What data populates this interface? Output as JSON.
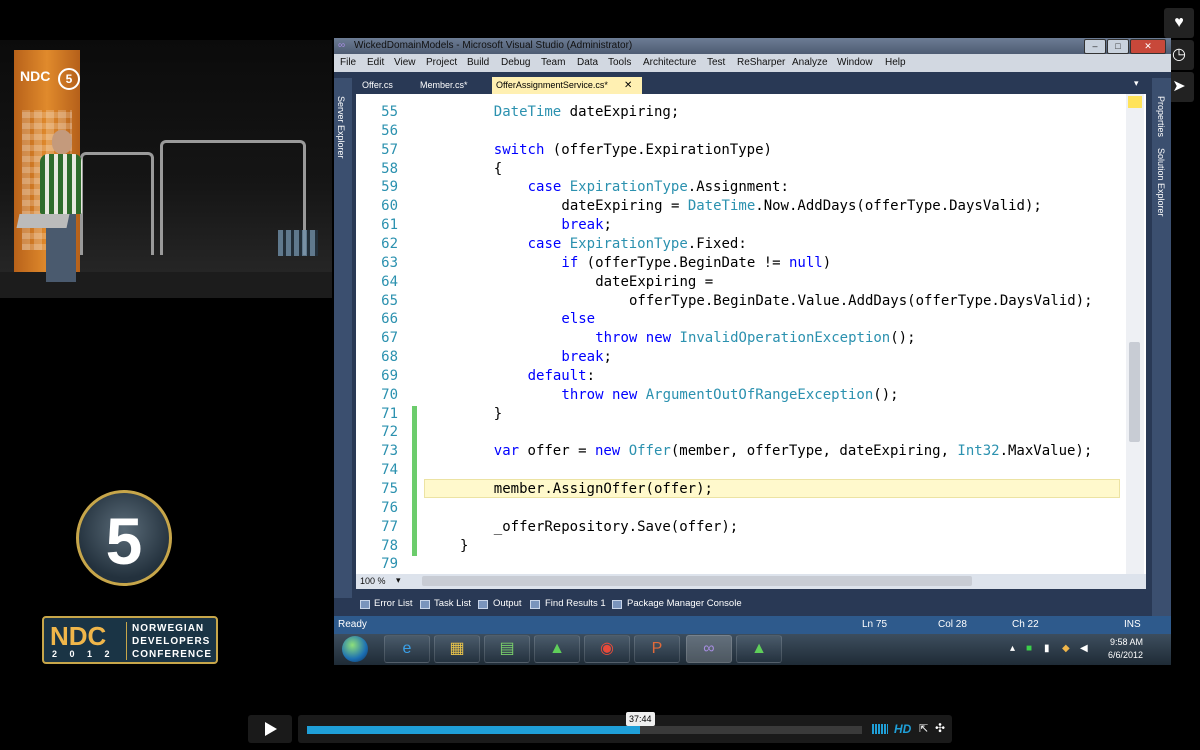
{
  "vs": {
    "window_title": "WickedDomainModels - Microsoft Visual Studio (Administrator)",
    "menu": [
      "File",
      "Edit",
      "View",
      "Project",
      "Build",
      "Debug",
      "Team",
      "Data",
      "Tools",
      "Architecture",
      "Test",
      "ReSharper",
      "Analyze",
      "Window",
      "Help"
    ],
    "tabs": [
      "Offer.cs",
      "Member.cs*",
      "OfferAssignmentService.cs*"
    ],
    "left_panel_label": "Server Explorer",
    "right_panel_labels": [
      "Properties",
      "Solution Explorer"
    ],
    "code_lines": [
      {
        "n": "55",
        "indent": "    ",
        "tokens": [
          [
            "ty",
            "DateTime"
          ],
          [
            "",
            "dateExpiring;"
          ]
        ]
      },
      {
        "n": "56",
        "indent": "",
        "tokens": []
      },
      {
        "n": "57",
        "indent": "    ",
        "tokens": [
          [
            "kw",
            "switch"
          ],
          [
            "",
            " (offerType.ExpirationType)"
          ]
        ]
      },
      {
        "n": "58",
        "indent": "    ",
        "tokens": [
          [
            "",
            "{"
          ]
        ]
      },
      {
        "n": "59",
        "indent": "        ",
        "tokens": [
          [
            "kw",
            "case"
          ],
          [
            "",
            " "
          ],
          [
            "ty",
            "ExpirationType"
          ],
          [
            "",
            ".Assignment:"
          ]
        ]
      },
      {
        "n": "60",
        "indent": "            ",
        "tokens": [
          [
            "",
            "dateExpiring = "
          ],
          [
            "ty",
            "DateTime"
          ],
          [
            "",
            ".Now.AddDays(offerType.DaysValid);"
          ]
        ]
      },
      {
        "n": "61",
        "indent": "            ",
        "tokens": [
          [
            "kw",
            "break"
          ],
          [
            "",
            ";"
          ]
        ]
      },
      {
        "n": "62",
        "indent": "        ",
        "tokens": [
          [
            "kw",
            "case"
          ],
          [
            "",
            " "
          ],
          [
            "ty",
            "ExpirationType"
          ],
          [
            "",
            ".Fixed:"
          ]
        ]
      },
      {
        "n": "63",
        "indent": "            ",
        "tokens": [
          [
            "kw",
            "if"
          ],
          [
            "",
            " (offerType.BeginDate != "
          ],
          [
            "kw",
            "null"
          ],
          [
            "",
            ")"
          ]
        ]
      },
      {
        "n": "64",
        "indent": "                ",
        "tokens": [
          [
            "",
            "dateExpiring ="
          ]
        ]
      },
      {
        "n": "65",
        "indent": "                    ",
        "tokens": [
          [
            "",
            "offerType.BeginDate.Value.AddDays(offerType.DaysValid);"
          ]
        ]
      },
      {
        "n": "66",
        "indent": "            ",
        "tokens": [
          [
            "kw",
            "else"
          ]
        ]
      },
      {
        "n": "67",
        "indent": "                ",
        "tokens": [
          [
            "kw",
            "throw"
          ],
          [
            "",
            " "
          ],
          [
            "kw",
            "new"
          ],
          [
            "",
            " "
          ],
          [
            "ty",
            "InvalidOperationException"
          ],
          [
            "",
            "();"
          ]
        ]
      },
      {
        "n": "68",
        "indent": "            ",
        "tokens": [
          [
            "kw",
            "break"
          ],
          [
            "",
            ";"
          ]
        ]
      },
      {
        "n": "69",
        "indent": "        ",
        "tokens": [
          [
            "kw",
            "default"
          ],
          [
            "",
            ":"
          ]
        ]
      },
      {
        "n": "70",
        "indent": "            ",
        "tokens": [
          [
            "kw",
            "throw"
          ],
          [
            "",
            " "
          ],
          [
            "kw",
            "new"
          ],
          [
            "",
            " "
          ],
          [
            "ty",
            "ArgumentOutOfRangeException"
          ],
          [
            "",
            "();"
          ]
        ]
      },
      {
        "n": "71",
        "indent": "    ",
        "tokens": [
          [
            "",
            "}"
          ]
        ]
      },
      {
        "n": "72",
        "indent": "",
        "tokens": []
      },
      {
        "n": "73",
        "indent": "    ",
        "tokens": [
          [
            "kw",
            "var"
          ],
          [
            "",
            " offer = "
          ],
          [
            "kw",
            "new"
          ],
          [
            "",
            " "
          ],
          [
            "ty",
            "Offer"
          ],
          [
            "",
            "(member, offerType, dateExpiring, "
          ],
          [
            "ty",
            "Int32"
          ],
          [
            "",
            ".MaxValue);"
          ]
        ]
      },
      {
        "n": "74",
        "indent": "",
        "tokens": []
      },
      {
        "n": "75",
        "indent": "    ",
        "tokens": [
          [
            "",
            "member.AssignOffer(offer);"
          ]
        ]
      },
      {
        "n": "76",
        "indent": "",
        "tokens": []
      },
      {
        "n": "77",
        "indent": "    ",
        "tokens": [
          [
            "",
            "_offerRepository.Save(offer);"
          ]
        ]
      },
      {
        "n": "78",
        "indent": "",
        "tokens": [
          [
            "",
            "}"
          ]
        ]
      },
      {
        "n": "79",
        "indent": "",
        "tokens": []
      }
    ],
    "zoom": "100 %",
    "tool_tabs": [
      "Error List",
      "Task List",
      "Output",
      "Find Results 1",
      "Package Manager Console"
    ],
    "status": {
      "ready": "Ready",
      "ln": "Ln 75",
      "col": "Col 28",
      "ch": "Ch 22",
      "ins": "INS"
    }
  },
  "taskbar": {
    "time": "9:58 AM",
    "date": "6/6/2012"
  },
  "player": {
    "timestamp": "37:44",
    "progress": 0.6,
    "hd": "HD"
  },
  "logo": {
    "number": "5",
    "ndc": "NDC",
    "lines": [
      "NORWEGIAN",
      "DEVELOPERS",
      "CONFERENCE"
    ],
    "year": "2 0 1 2"
  },
  "banner": {
    "ndc": "NDC",
    "number": "5"
  }
}
